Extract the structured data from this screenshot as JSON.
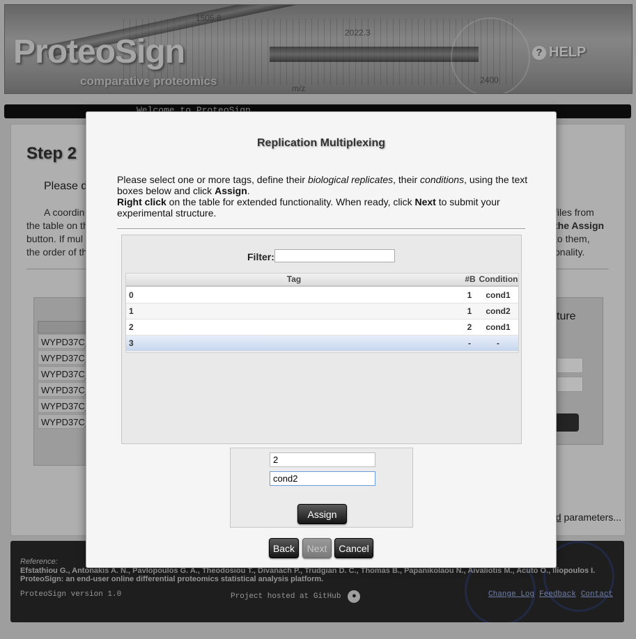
{
  "header": {
    "logo": "ProteoSign",
    "tagline": "comparative proteomics",
    "help_label": "HELP",
    "help_icon": "question-circle-icon",
    "axis_labels": [
      "1505.8",
      "2022.3",
      "m/z",
      "2400"
    ]
  },
  "welcome": "Welcome to ProteoSign",
  "background_page": {
    "step_title": "Step 2",
    "desc": "Please d",
    "lines": [
      "A coordin",
      "the table on th",
      "button. If mul",
      "the order of th"
    ],
    "right_fragments": [
      "files from",
      "the Assign",
      "to them,",
      "onality."
    ],
    "left_panel_rows": [
      "WYPD37C_",
      "WYPD37C_",
      "WYPD37C_",
      "WYPD37C_",
      "WYPD37C_",
      "WYPD37C_"
    ],
    "right_panel_title": "ture",
    "load_link": "ad",
    "load_suffix": " parameters..."
  },
  "dialog": {
    "title": "Replication Multiplexing",
    "instructions": {
      "p1_a": "Please select one or more tags, define their ",
      "p1_b": "biological replicates",
      "p1_c": ", their ",
      "p1_d": "conditions",
      "p1_e": ", using the text boxes below and click ",
      "p1_f": "Assign",
      "p1_g": ".",
      "p2_a": "Right click",
      "p2_b": " on the table for extended functionality. When ready, click ",
      "p2_c": "Next",
      "p2_d": " to submit your experimental structure."
    },
    "filter_label": "Filter:",
    "filter_value": "",
    "columns": {
      "tag": "Tag",
      "b": "#B",
      "condition": "Condition"
    },
    "rows": [
      {
        "tag": "0",
        "b": "1",
        "condition": "cond1"
      },
      {
        "tag": "1",
        "b": "1",
        "condition": "cond2"
      },
      {
        "tag": "2",
        "b": "2",
        "condition": "cond1"
      },
      {
        "tag": "3",
        "b": "-",
        "condition": "-"
      }
    ],
    "selected_row_tag": "3",
    "replicate_value": "2",
    "condition_value": "cond2",
    "assign_label": "Assign",
    "back_label": "Back",
    "next_label": "Next",
    "cancel_label": "Cancel"
  },
  "footer": {
    "ref_label": "Reference:",
    "ref_authors": "Efstathiou G., Antonakis A. N., Pavlopoulos G. A., Theodosiou T., Divanach P., Trudgian D. C., Thomas B., Papanikolaou N., Aivaliotis M., Acuto O., Iliopoulos I.",
    "ref_title": "ProteoSign: an end-user online differential proteomics statistical analysis platform.",
    "version": "ProteoSign version 1.0",
    "github_text": "Project hosted at GitHub",
    "github_icon": "github-icon",
    "links": [
      "Change Log",
      "Feedback",
      "Contact"
    ]
  },
  "colors": {
    "accent_blue": "#c7d6ee",
    "footer_bg": "#2a2a2a",
    "button_dark": "#161616"
  }
}
